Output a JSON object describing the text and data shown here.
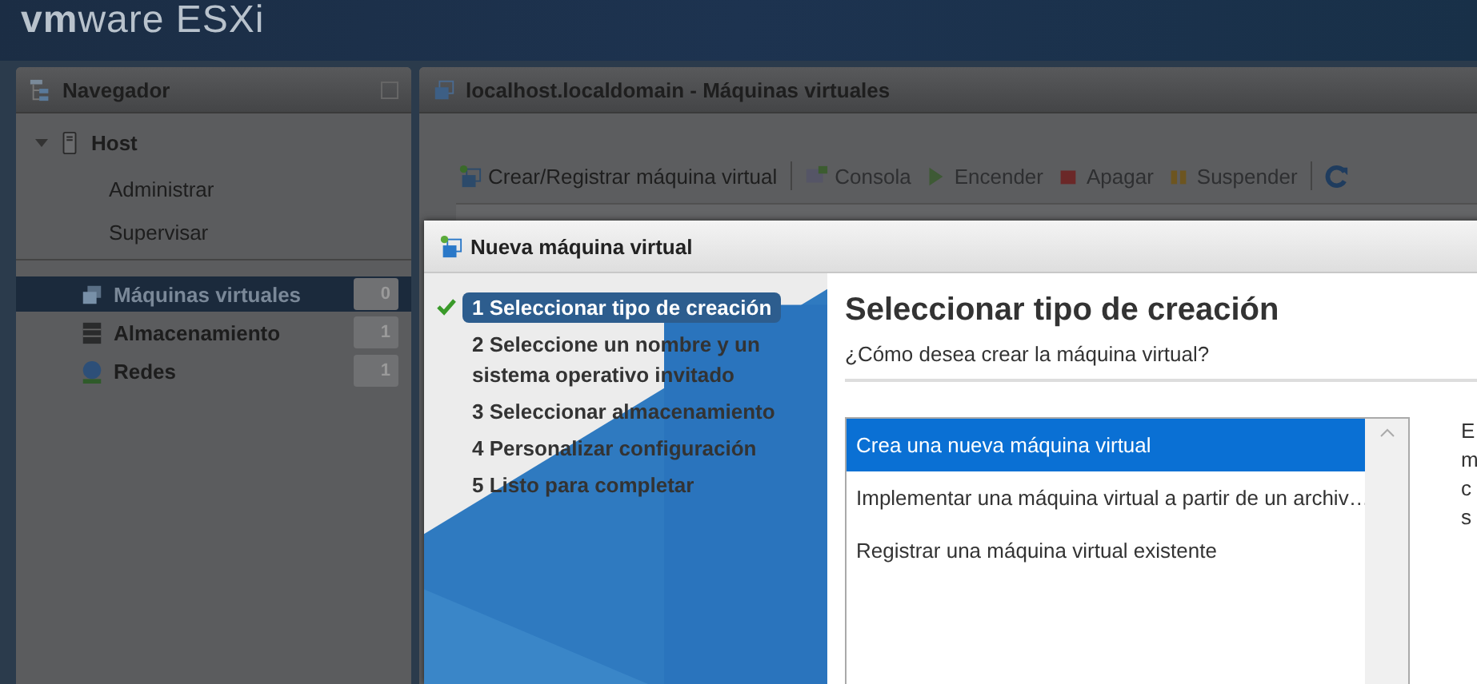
{
  "header": {
    "logo": "**vm**ware ESXi"
  },
  "navigator": {
    "title": "Navegador",
    "host": {
      "label": "Host",
      "expanded": true,
      "children": [
        {
          "label": "Administrar"
        },
        {
          "label": "Supervisar"
        }
      ]
    },
    "items": [
      {
        "label": "Máquinas virtuales",
        "count": "0",
        "selected": true,
        "kind": "vms"
      },
      {
        "label": "Almacenamiento",
        "count": "1",
        "selected": false,
        "kind": "storage"
      },
      {
        "label": "Redes",
        "count": "1",
        "selected": false,
        "kind": "network"
      }
    ]
  },
  "main": {
    "title": "localhost.localdomain - Máquinas virtuales",
    "toolbar": [
      {
        "label": "Crear/Registrar máquina virtual",
        "kind": "create",
        "disabled": false
      },
      {
        "label": "Consola",
        "kind": "console",
        "disabled": true
      },
      {
        "label": "Encender",
        "kind": "play",
        "disabled": true
      },
      {
        "label": "Apagar",
        "kind": "stop",
        "disabled": true
      },
      {
        "label": "Suspender",
        "kind": "pause",
        "disabled": true
      },
      {
        "kind": "refresh"
      }
    ]
  },
  "dialog": {
    "title": "Nueva máquina virtual",
    "steps": [
      {
        "label": "1 Seleccionar tipo de creación",
        "selected": true,
        "done": true
      },
      {
        "label": "2 Seleccione un nombre y un sistema operativo invitado",
        "selected": false,
        "done": false
      },
      {
        "label": "3 Seleccionar almacenamiento",
        "selected": false,
        "done": false
      },
      {
        "label": "4 Personalizar configuración",
        "selected": false,
        "done": false
      },
      {
        "label": "5 Listo para completar",
        "selected": false,
        "done": false
      }
    ],
    "heading": "Seleccionar tipo de creación",
    "question": "¿Cómo desea crear la máquina virtual?",
    "options": [
      {
        "label": "Crea una nueva máquina virtual",
        "selected": true
      },
      {
        "label": "Implementar una máquina virtual a partir de un archiv…",
        "selected": false
      },
      {
        "label": "Registrar una máquina virtual existente",
        "selected": false
      }
    ],
    "description_lines": [
      "E",
      "m",
      "c",
      "s"
    ]
  }
}
